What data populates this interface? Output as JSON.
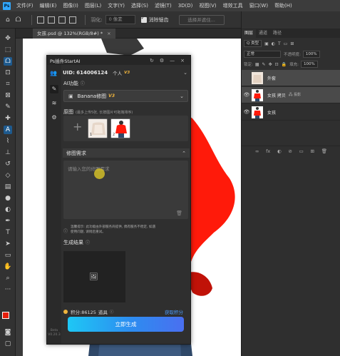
{
  "menubar": {
    "logo": "Ps",
    "items": [
      "文件(F)",
      "编辑(E)",
      "图像(I)",
      "图层(L)",
      "文字(Y)",
      "选择(S)",
      "滤镜(T)",
      "3D(D)",
      "视图(V)",
      "增效工具",
      "窗口(W)",
      "帮助(H)"
    ]
  },
  "optbar": {
    "feather_label": "羽化:",
    "feather_value": "0 像素",
    "antialias_label": "消除锯齿",
    "select_subject": "选择并遮住..."
  },
  "doc": {
    "tab_title": "女孩.psd @ 132%(RGB/8#) *",
    "close": "×"
  },
  "plugin": {
    "title": "Ps插件StartAI",
    "uid": "UID: 614006124",
    "plan": "个人",
    "plan_badge": "V3",
    "ai_label": "AI功能",
    "func_name": "Banana修图",
    "func_badge": "V3",
    "orig_label": "原图",
    "orig_hint": "(最多上传5张, 长按图片可拖拽排序)",
    "thumbs": [
      "1",
      "2"
    ],
    "req_label": "修图需求",
    "req_placeholder": "请输入您的修图需求",
    "notice": "温馨提示: 此功能由外部服务商提供, 偶有服务不稳定, 如遇\n使用问题, 请稍后重试。",
    "result_label": "生成结果",
    "points": "积分:86125",
    "points_act": "道具",
    "get_points": "获取积分",
    "generate": "立即生成",
    "version": "Beta\nV0.20.3"
  },
  "right_panel": {
    "tabs": [
      "图层",
      "通道",
      "路径"
    ],
    "kind": "Q 类型",
    "blend": "正常",
    "opacity_label": "不透明度:",
    "opacity": "100%",
    "lock_label": "锁定:",
    "fill_label": "填充:",
    "fill": "100%",
    "layers": [
      {
        "name": "外套",
        "sub": "",
        "visible": false,
        "selected": true
      },
      {
        "name": "女孩 拷贝",
        "sub": "🖧 投影",
        "visible": true,
        "selected": true
      },
      {
        "name": "女孩",
        "sub": "",
        "visible": true,
        "selected": false
      }
    ],
    "bottom_icons": [
      "∞",
      "fx",
      "◐",
      "⊘",
      "▭",
      "⊞",
      "🗑"
    ]
  },
  "colors": {
    "accent": "#2d8cf0",
    "jacket_red": "#ff1a0a",
    "badge_gold": "#f0b43c",
    "link_blue": "#4c9cff"
  }
}
